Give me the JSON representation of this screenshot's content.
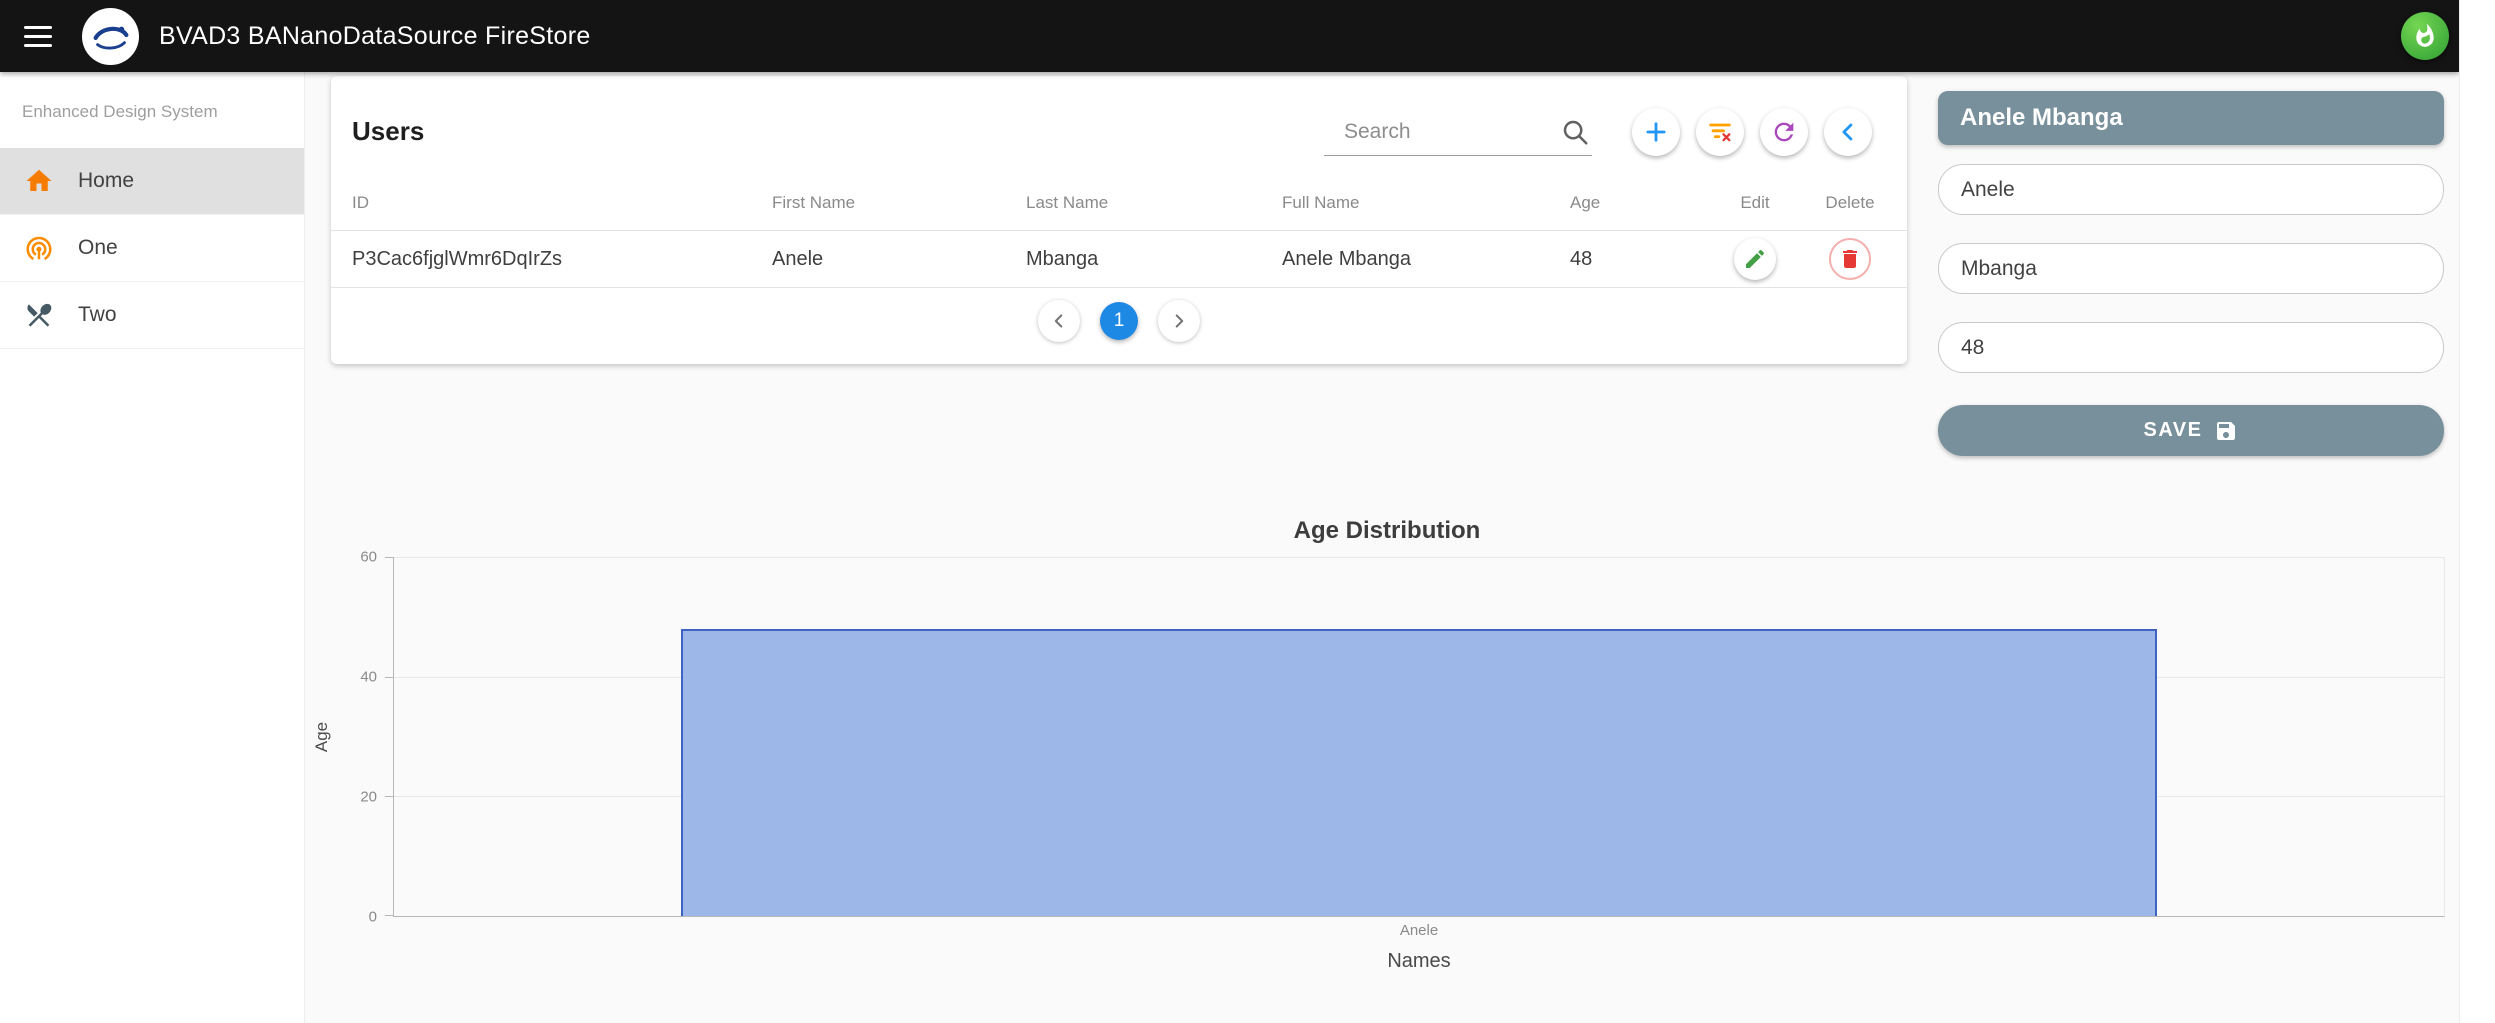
{
  "app_bar": {
    "title": "BVAD3 BANanoDataSource FireStore"
  },
  "sidebar": {
    "subtitle": "Enhanced Design System",
    "items": [
      {
        "label": "Home",
        "icon": "home-icon",
        "active": true
      },
      {
        "label": "One",
        "icon": "signal-icon",
        "active": false
      },
      {
        "label": "Two",
        "icon": "restaurant-icon",
        "active": false
      }
    ]
  },
  "users_card": {
    "title": "Users",
    "search_placeholder": "Search",
    "columns": [
      "ID",
      "First Name",
      "Last Name",
      "Full Name",
      "Age",
      "Edit",
      "Delete"
    ],
    "rows": [
      {
        "id": "P3Cac6fjglWmr6DqIrZs",
        "first_name": "Anele",
        "last_name": "Mbanga",
        "full_name": "Anele Mbanga",
        "age": "48"
      }
    ],
    "pagination": {
      "current_page": "1"
    }
  },
  "detail_panel": {
    "header": "Anele Mbanga",
    "first_name": "Anele",
    "last_name": "Mbanga",
    "age": "48",
    "save_label": "SAVE"
  },
  "chart_data": {
    "type": "bar",
    "title": "Age Distribution",
    "categories": [
      "Anele"
    ],
    "values": [
      48
    ],
    "xlabel": "Names",
    "ylabel": "Age",
    "ylim": [
      0,
      60
    ],
    "yticks": [
      0,
      20,
      40,
      60
    ],
    "grid": true,
    "legend": false,
    "bar_fill": "#9db7e8",
    "bar_border": "#3e63c0"
  },
  "colors": {
    "app_bar_bg": "#141414",
    "accent": "#78909c",
    "page_circle_blue": "#1e88e5",
    "fab_green": "#3aa838",
    "edit_green": "#43a047",
    "delete_red": "#e53935",
    "add_blue": "#2196f3",
    "filter_amber": "#ffa000",
    "refresh_purple": "#ab47bc",
    "sidebar_active_bg": "#e0e0e0",
    "home_orange": "#f57c00"
  },
  "icons": {
    "hamburger-icon": "three horizontal bars",
    "flame-icon": "white flame on green circle",
    "home-icon": "orange house",
    "signal-icon": "orange antenna waves",
    "restaurant-icon": "fork and knife",
    "search-icon": "magnifier",
    "add-icon": "blue plus",
    "filter-clear-icon": "amber funnel lines with red x",
    "refresh-icon": "purple circular arrow",
    "chevron-left-icon": "blue left chevron",
    "edit-icon": "green pencil",
    "delete-icon": "red trash can",
    "save-icon": "white floppy disk",
    "prev-icon": "gray left chevron",
    "next-icon": "gray right chevron"
  }
}
